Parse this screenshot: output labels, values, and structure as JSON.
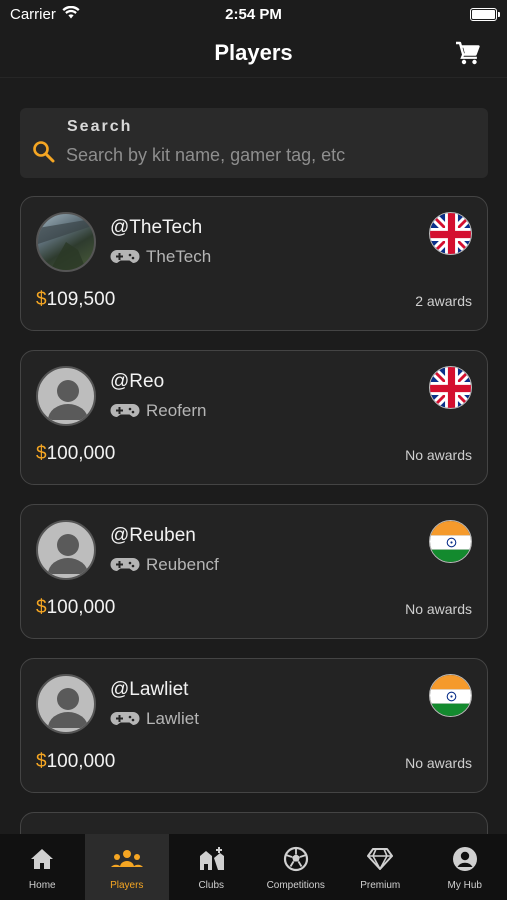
{
  "status": {
    "carrier": "Carrier",
    "time": "2:54 PM"
  },
  "header": {
    "title": "Players",
    "cart_icon": "cart-icon"
  },
  "search": {
    "label": "Search",
    "placeholder": "Search by kit name, gamer tag, etc"
  },
  "accent_color": "#f5a623",
  "players": [
    {
      "tag": "@TheTech",
      "gamer_tag": "TheTech",
      "price": "109,500",
      "currency": "$",
      "awards": "2 awards",
      "country": "uk-flag",
      "avatar": "photo"
    },
    {
      "tag": "@Reo",
      "gamer_tag": "Reofern",
      "price": "100,000",
      "currency": "$",
      "awards": "No awards",
      "country": "uk-flag",
      "avatar": "placeholder"
    },
    {
      "tag": "@Reuben",
      "gamer_tag": "Reubencf",
      "price": "100,000",
      "currency": "$",
      "awards": "No awards",
      "country": "india-flag",
      "avatar": "placeholder"
    },
    {
      "tag": "@Lawliet",
      "gamer_tag": "Lawliet",
      "price": "100,000",
      "currency": "$",
      "awards": "No awards",
      "country": "india-flag",
      "avatar": "placeholder"
    }
  ],
  "tabs": [
    {
      "label": "Home",
      "icon": "home-icon"
    },
    {
      "label": "Players",
      "icon": "players-icon",
      "active": true
    },
    {
      "label": "Clubs",
      "icon": "clubs-icon"
    },
    {
      "label": "Competitions",
      "icon": "soccer-ball-icon"
    },
    {
      "label": "Premium",
      "icon": "diamond-icon"
    },
    {
      "label": "My Hub",
      "icon": "account-icon"
    }
  ]
}
